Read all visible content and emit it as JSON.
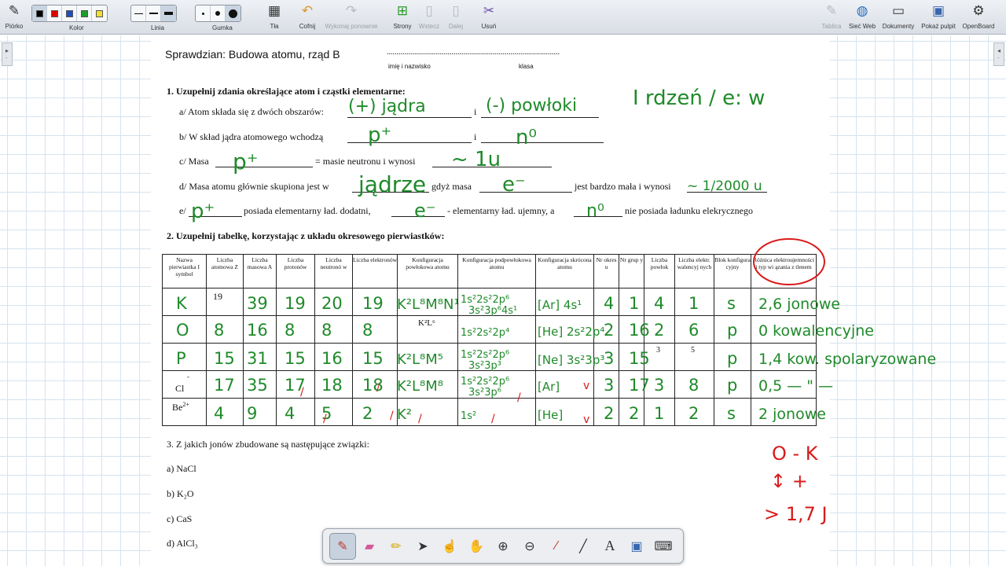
{
  "toolbar": {
    "pen_label": "Piórko",
    "color_label": "Kolor",
    "colors": [
      "#000000",
      "#e00000",
      "#1f4fbf",
      "#1d9d2a",
      "#f0e030"
    ],
    "line_label": "Linia",
    "eraser_label": "Gumka",
    "background_label": "Tła",
    "undo_label": "Cofnij",
    "redo_label": "Wykonaj ponownie",
    "pages_label": "Strony",
    "paste_label": "Wstecz",
    "next_label": "Dalej",
    "delete_label": "Usuń",
    "table_label": "Tablica",
    "web_label": "Sieć Web",
    "documents_label": "Dokumenty",
    "desktop_label": "Pokaż pulpit",
    "openboard_label": "OpenBoard"
  },
  "sheet": {
    "title": "Sprawdzian: Budowa atomu, rząd B",
    "dots": "........................................................................................",
    "name_caption": "imię i nazwisko",
    "class_caption": "klasa",
    "q1": {
      "heading": "1. Uzupełnij zdania określające atom i cząstki elementarne:",
      "a_prefix": "a/ Atom składa się z dwóch obszarów:",
      "a_mid": "i",
      "b_prefix": "b/ W skład jądra atomowego wchodzą",
      "b_mid": "i",
      "c_prefix": "c/ Masa",
      "c_mid": "= masie neutronu i wynosi",
      "d_prefix": "d/ Masa atomu głównie skupiona jest w",
      "d_mid1": "gdyż masa",
      "d_mid2": "jest bardzo mała i wynosi",
      "e_prefix": "e/",
      "e_mid1": "posiada elementarny ład. dodatni,",
      "e_mid2": "- elementarny ład. ujemny, a",
      "e_end": "nie posiada ładunku elekrycznego"
    },
    "q2": {
      "heading": "2. Uzupełnij tabelkę, korzystając z układu okresowego pierwiastków:",
      "columns": [
        "Nazwa pierwiastka I symbol",
        "Liczba atomowa Z",
        "Liczba masowa A",
        "Liczba protonów",
        "Liczba neutronó w",
        "Liczba elektronów",
        "Konfiguracja powłokowa atomu",
        "Konfiguracja podpowłokowa atomu",
        "Konfiguracja skrócona atomu",
        "Nr okres u",
        "Nr grup y",
        "Liczba powłok",
        "Liczba elektr. walencyj nych",
        "Blok konfigura cyjny",
        "Różnica elektroujemności i typ wi ązania z tlenem"
      ],
      "printed": {
        "k_z": "19",
        "o_config": "K²L⁶",
        "p_shells": "3",
        "p_valence": "5",
        "cl_symbol": "Cl",
        "cl_sup": "-",
        "be_symbol": "Be",
        "be_sup": "2+"
      }
    },
    "q3": {
      "heading": "3. Z jakich jonów zbudowane są następujące związki:",
      "items": [
        "a) NaCl",
        "b) K₂O",
        "c) CaS",
        "d) AlCl₃"
      ]
    }
  },
  "handwriting": {
    "q1a_1": "(+) jądra",
    "q1a_2": "(-) powłoki",
    "q1a_note": "I rdzeń / e: w",
    "q1b_1": "p⁺",
    "q1b_2": "n⁰",
    "q1c_1": "p⁺",
    "q1c_2": "~ 1u",
    "q1d_1": "jądrze",
    "q1d_2": "e⁻",
    "q1d_3": "~ 1/2000 u",
    "q1e_1": "p⁺",
    "q1e_2": "e⁻",
    "q1e_3": "n⁰",
    "rows": [
      [
        "K",
        "",
        "39",
        "19",
        "20",
        "19",
        "K²L⁸M⁸N¹",
        "1s²2s²2p⁶ 3s²3p⁶4s¹",
        "[Ar] 4s¹",
        "4",
        "1",
        "4",
        "1",
        "s",
        "2,6 jonowe"
      ],
      [
        "O",
        "8",
        "16",
        "8",
        "8",
        "8",
        "",
        "1s²2s²2p⁴",
        "[He] 2s²2p⁴",
        "2",
        "16",
        "2",
        "6",
        "p",
        "0 kowalencyjne"
      ],
      [
        "P",
        "15",
        "31",
        "15",
        "16",
        "15",
        "K²L⁸M⁵",
        "1s²2s²2p⁶ 3s²3p³",
        "[Ne] 3s²3p³",
        "3",
        "15",
        "",
        "",
        "p",
        "1,4 kow. spolaryzowane"
      ],
      [
        "",
        "17",
        "35",
        "17",
        "18",
        "18",
        "K²L⁸M⁸",
        "1s²2s²2p⁶ 3s²3p⁶",
        "[Ar]",
        "3",
        "17",
        "3",
        "8",
        "p",
        "0,5 — \" —"
      ],
      [
        "",
        "4",
        "9",
        "4",
        "5",
        "2",
        "K²",
        "1s²",
        "[He]",
        "2",
        "2",
        "1",
        "2",
        "s",
        "2 jonowe"
      ]
    ],
    "side_1": "O - K",
    "side_2": "↕ +",
    "side_3": "> 1,7 J"
  },
  "dock": {
    "tools": [
      "pen-icon",
      "eraser-icon",
      "marker-icon",
      "pointer-icon",
      "hand-pointer-icon",
      "grab-icon",
      "zoom-in-icon",
      "zoom-out-icon",
      "laser-icon",
      "line-icon",
      "text-icon",
      "capture-icon",
      "keyboard-icon"
    ],
    "text_tool_label": "A"
  },
  "colors": {
    "ink": "#1f8a2a",
    "ink_red": "#d81b1b",
    "annotation_circle": "#d81b1b",
    "grid": "#d6e3ee"
  }
}
